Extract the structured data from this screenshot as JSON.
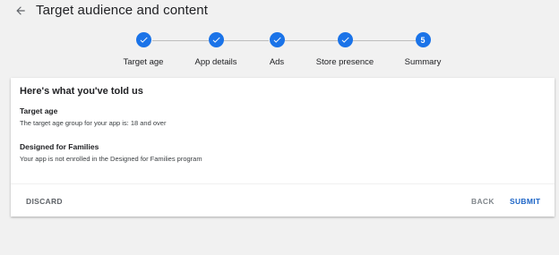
{
  "header": {
    "back_icon": "arrow-left-icon",
    "title": "Target audience and content"
  },
  "stepper": {
    "steps": [
      {
        "label": "Target age",
        "state": "done",
        "icon": "check-icon"
      },
      {
        "label": "App details",
        "state": "done",
        "icon": "check-icon"
      },
      {
        "label": "Ads",
        "state": "done",
        "icon": "check-icon"
      },
      {
        "label": "Store presence",
        "state": "done",
        "icon": "check-icon"
      },
      {
        "label": "Summary",
        "state": "current",
        "number": "5"
      }
    ]
  },
  "summary": {
    "title": "Here's what you've told us",
    "sections": [
      {
        "heading": "Target age",
        "text": "The target age group for your app is: 18 and over"
      },
      {
        "heading": "Designed for Families",
        "text": "Your app is not enrolled in the Designed for Families program"
      }
    ]
  },
  "footer": {
    "discard_label": "DISCARD",
    "back_label": "BACK",
    "submit_label": "SUBMIT"
  },
  "colors": {
    "accent": "#1a73e8",
    "submit": "#1a63c6",
    "muted_button": "#80868b",
    "background": "#f1f1f1"
  }
}
